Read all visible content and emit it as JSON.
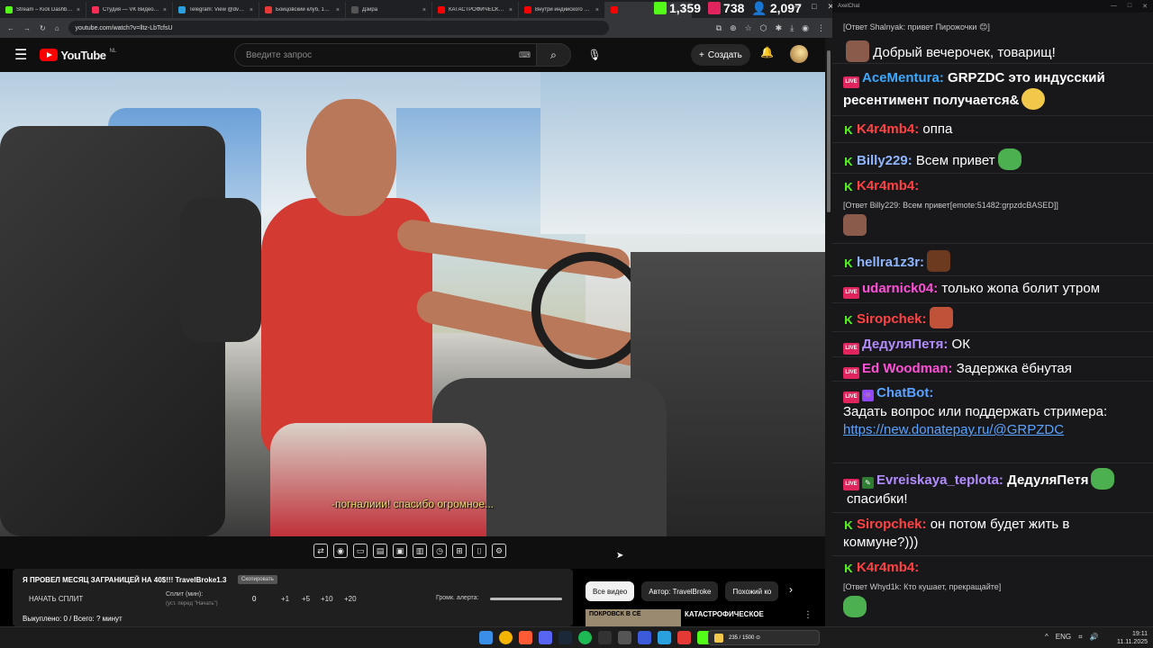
{
  "browser": {
    "tabs": [
      {
        "label": "Stream – Kick Dashboard",
        "color": "#53fc18"
      },
      {
        "label": "Студия — VK Видео Live",
        "color": "#ff2d55"
      },
      {
        "label": "Telegram: View @dvach",
        "color": "#2aa1de"
      },
      {
        "label": "Бойцовский клуб, 1999",
        "color": "#e53935"
      },
      {
        "label": "Дзи́ра",
        "color": "#555555"
      },
      {
        "label": "КАТАСТРОФИЧЕСКОЕ",
        "color": "#ff0000"
      },
      {
        "label": "Внутри индийского ф...",
        "color": "#ff0000"
      },
      {
        "label": "",
        "color": "#ff0000",
        "active": true
      }
    ],
    "url": "youtube.com/watch?v=lltz-LbTcfsU"
  },
  "counters": {
    "kick": "1,359",
    "vk": "738",
    "total": "2,097"
  },
  "youtube": {
    "logo_text": "YouTube",
    "region": "NL",
    "search_placeholder": "Введите запрос",
    "create_label": "Создать"
  },
  "video": {
    "subtitle": "-погналиии! спасибо огромное..."
  },
  "split_panel": {
    "title": "Я ПРОВЕЛ МЕСЯЦ ЗАГРАНИЦЕЙ НА 40$!!! TravelBroke1.3",
    "copy_label": "Скопировать",
    "start_label": "НАЧАТЬ СПЛИТ",
    "split_label": "Сплит (мин):",
    "split_hint": "(уст. перед \"Начать\")",
    "split_value": "0",
    "steps": [
      "+1",
      "+5",
      "+10",
      "+20"
    ],
    "volume_label": "Громк. алерта:",
    "total_text": "Выкуплено: 0 / Всего: ? минут"
  },
  "recommendations": {
    "chips": [
      "Все видео",
      "Автор: TravelBroke",
      "Похожий ко"
    ],
    "thumb_text": "ПОКРОВСК В СЁ",
    "title": "КАТАСТРОФИЧЕСКОЕ"
  },
  "chat": {
    "app_title": "AxelChat",
    "top_reply": "[Ответ Shalnyak: привет Пирожочки 😊]",
    "messages": [
      {
        "user": "",
        "text": "Добрый вечерочек, товарищ!",
        "badge": "",
        "color": "#ffffff"
      },
      {
        "user": "AceMentura:",
        "text": "GRPZDC это индусский ресентимент получается&",
        "badge": "live",
        "color": "#3ba9ff"
      },
      {
        "user": "K4r4mb4:",
        "text": "оппа",
        "badge": "kick",
        "color": "#ff4242"
      },
      {
        "user": "Billy229:",
        "text": "Всем привет",
        "badge": "kick",
        "color": "#8fb6ff"
      },
      {
        "user": "K4r4mb4:",
        "text": "",
        "badge": "kick",
        "color": "#ff4242"
      },
      {
        "user": "",
        "text": "[Ответ Billy229: Всем привет[emote:51482:grpzdcBASED]]",
        "badge": "",
        "color": "#c8c8c8"
      },
      {
        "user": "hellra1z3r:",
        "text": "",
        "badge": "kick",
        "color": "#8fb6ff"
      },
      {
        "user": "udarnick04:",
        "text": "только жопа болит утром",
        "badge": "live",
        "color": "#ff4fd8"
      },
      {
        "user": "Siropchek:",
        "text": "",
        "badge": "kick",
        "color": "#ff4242"
      },
      {
        "user": "ДедуляПетя:",
        "text": "ОК",
        "badge": "live",
        "color": "#b28cff"
      },
      {
        "user": "Ed Woodman:",
        "text": "Задержка ёбнутая",
        "badge": "live",
        "color": "#ff4fd8"
      },
      {
        "user": "ChatBot:",
        "text": "",
        "badge": "live",
        "color": "#5aa2ff"
      },
      {
        "user": "",
        "text": "Задать вопрос или поддержать стримера:",
        "badge": "",
        "color": "#ffffff"
      },
      {
        "user": "",
        "text": "https://new.donatepay.ru/@GRPZDC",
        "badge": "",
        "color": "#5aa2ff"
      },
      {
        "user": "Evreiskaya_teplota:",
        "text": "ДедуляПетя",
        "badge": "live",
        "color": "#b28cff"
      },
      {
        "user": "",
        "text": "спасибки!",
        "badge": "",
        "color": "#ffffff"
      },
      {
        "user": "Siropchek:",
        "text": "он потом будет жить в коммуне?)))",
        "badge": "kick",
        "color": "#ff4242"
      },
      {
        "user": "K4r4mb4:",
        "text": "",
        "badge": "kick",
        "color": "#ff4242"
      },
      {
        "user": "",
        "text": "[Ответ Whyd1k: Кто кушает, прекращайте]",
        "badge": "",
        "color": "#c8c8c8"
      }
    ]
  },
  "taskbar": {
    "widget_text": "235 / 1500 ⊙",
    "lang": "ENG",
    "time": "19:11",
    "date": "11.11.2025"
  }
}
